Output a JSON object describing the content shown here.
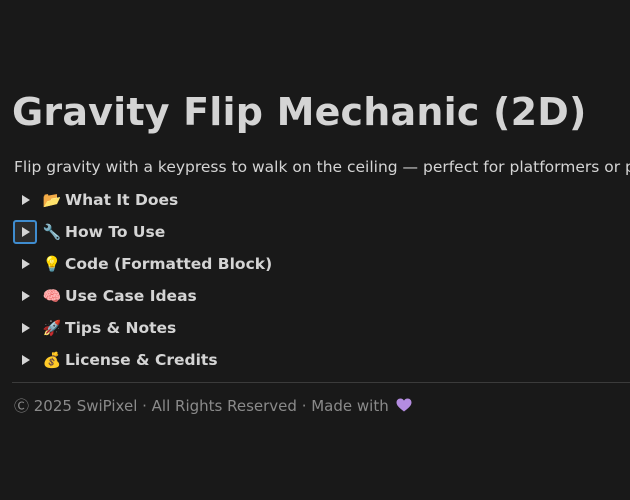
{
  "page": {
    "title": "Gravity Flip Mechanic (2D)",
    "description": "Flip gravity with a keypress to walk on the ceiling — perfect for platformers or puzzle ga"
  },
  "toggles": [
    {
      "emoji": "📂",
      "icon": "folder-icon",
      "label": "What It Does",
      "focused": false
    },
    {
      "emoji": "🔧",
      "icon": "wrench-icon",
      "label": "How To Use",
      "focused": true
    },
    {
      "emoji": "💡",
      "icon": "lightbulb-icon",
      "label": "Code (Formatted Block)",
      "focused": false
    },
    {
      "emoji": "🧠",
      "icon": "brain-icon",
      "label": "Use Case Ideas",
      "focused": false
    },
    {
      "emoji": "🚀",
      "icon": "rocket-icon",
      "label": "Tips & Notes",
      "focused": false
    },
    {
      "emoji": "💰",
      "icon": "money-bag-icon",
      "label": "License & Credits",
      "focused": false
    }
  ],
  "footer": {
    "text": "Ⓒ 2025 SwiPixel · All Rights Reserved · Made with",
    "heart_icon": "purple-heart-icon",
    "heart_color": "#b48ce0"
  },
  "colors": {
    "background": "#191919",
    "text": "#d4d4d4",
    "muted_text": "#8a8a8a",
    "focus_ring": "#3f8ccf",
    "divider": "#3b3b3b"
  }
}
